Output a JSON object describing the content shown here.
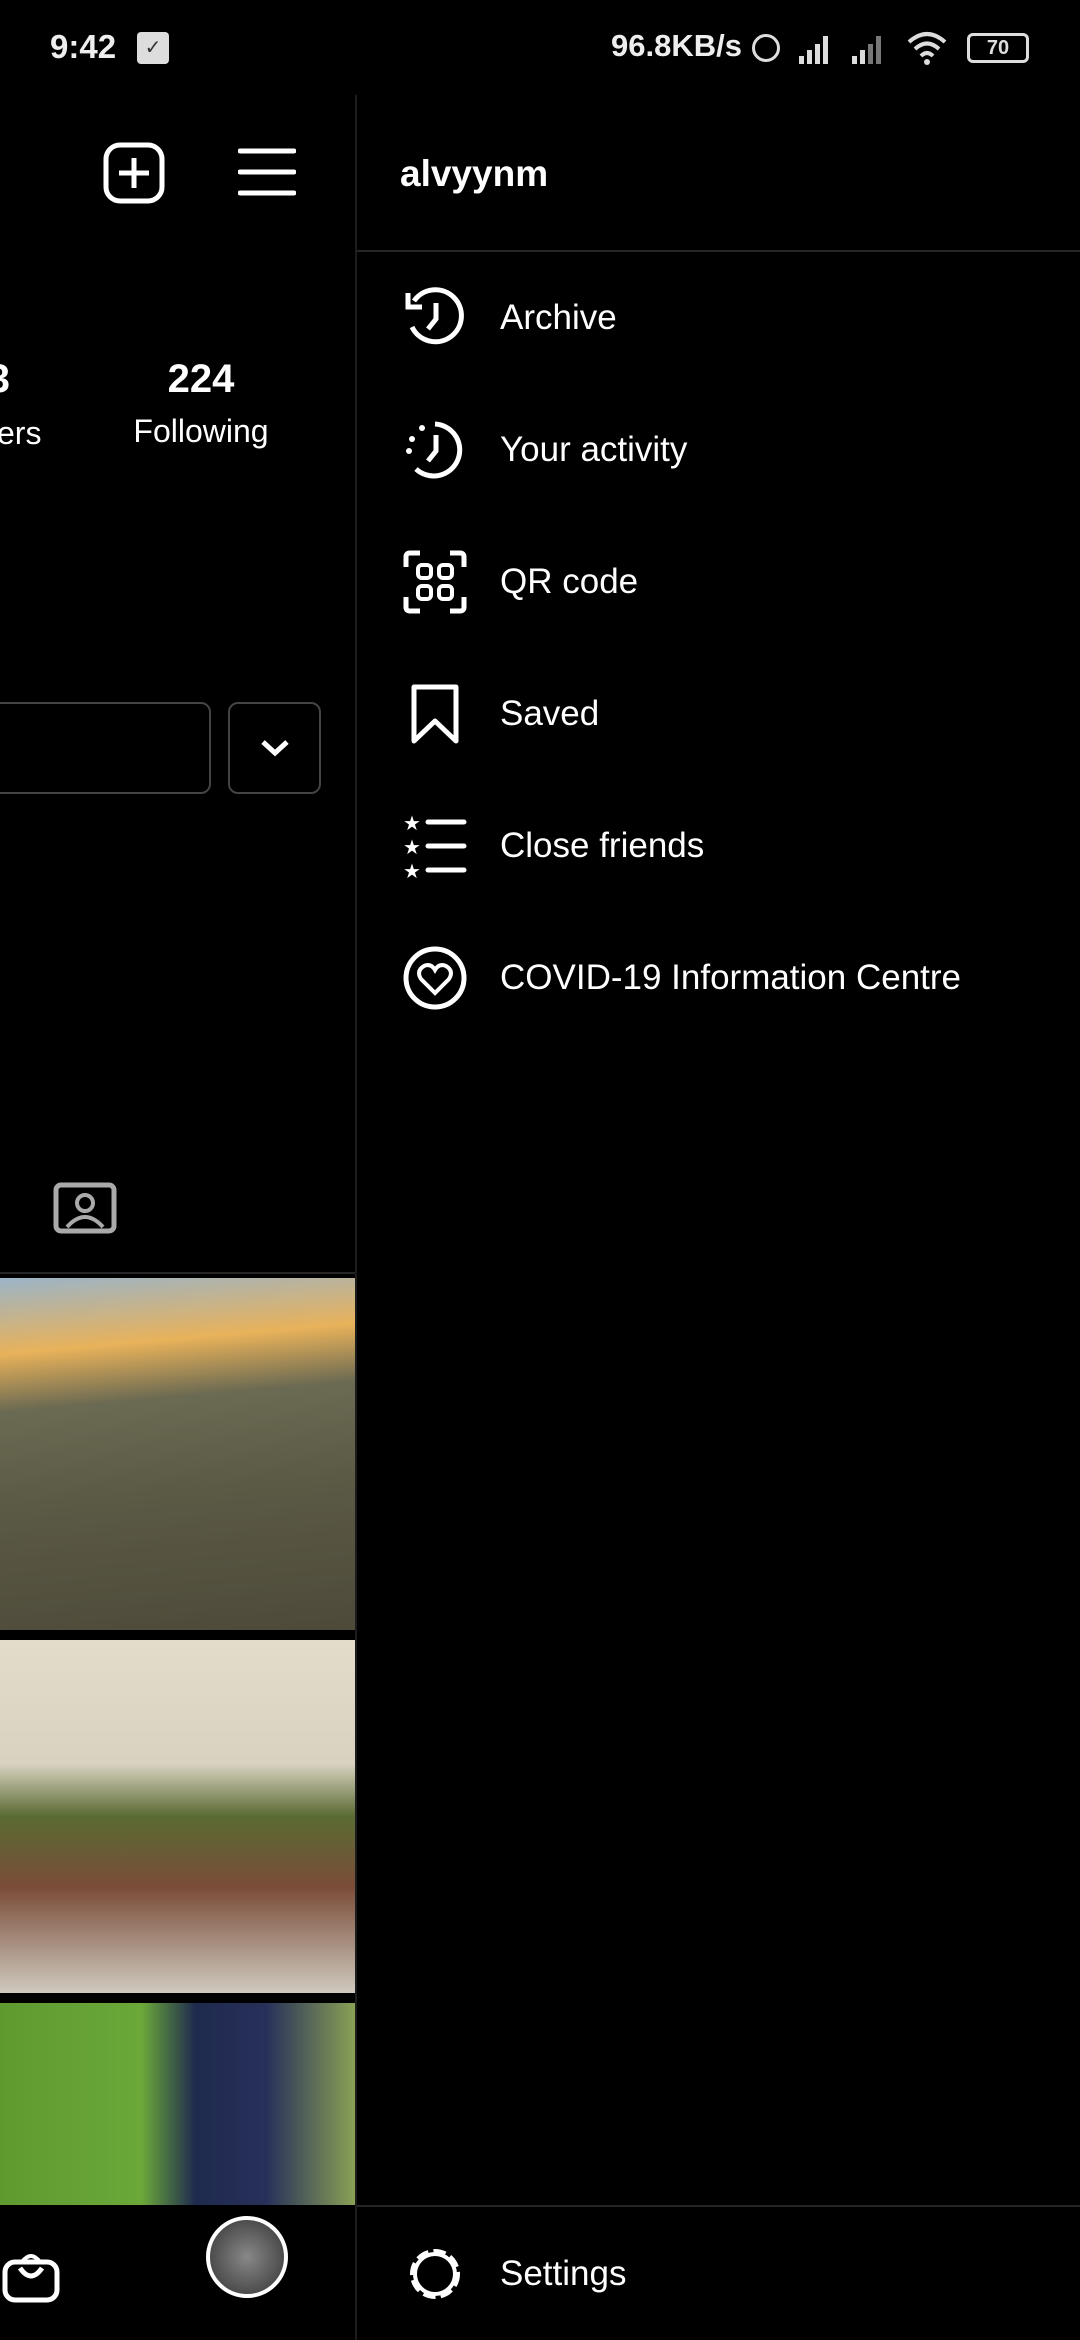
{
  "status_bar": {
    "time": "9:42",
    "net_speed": "96.8KB/s",
    "battery": "70"
  },
  "profile": {
    "following_count": "224",
    "following_label": "Following",
    "followers_label_partial": "ers",
    "followers_count_partial": "3"
  },
  "drawer": {
    "username": "alvyynm",
    "items": [
      {
        "label": "Archive",
        "icon": "archive-clock-icon"
      },
      {
        "label": "Your activity",
        "icon": "activity-clock-icon"
      },
      {
        "label": "QR code",
        "icon": "qr-code-icon"
      },
      {
        "label": "Saved",
        "icon": "bookmark-icon"
      },
      {
        "label": "Close friends",
        "icon": "close-friends-list-icon"
      },
      {
        "label": "COVID-19 Information Centre",
        "icon": "covid-heart-icon"
      }
    ],
    "settings_label": "Settings"
  }
}
